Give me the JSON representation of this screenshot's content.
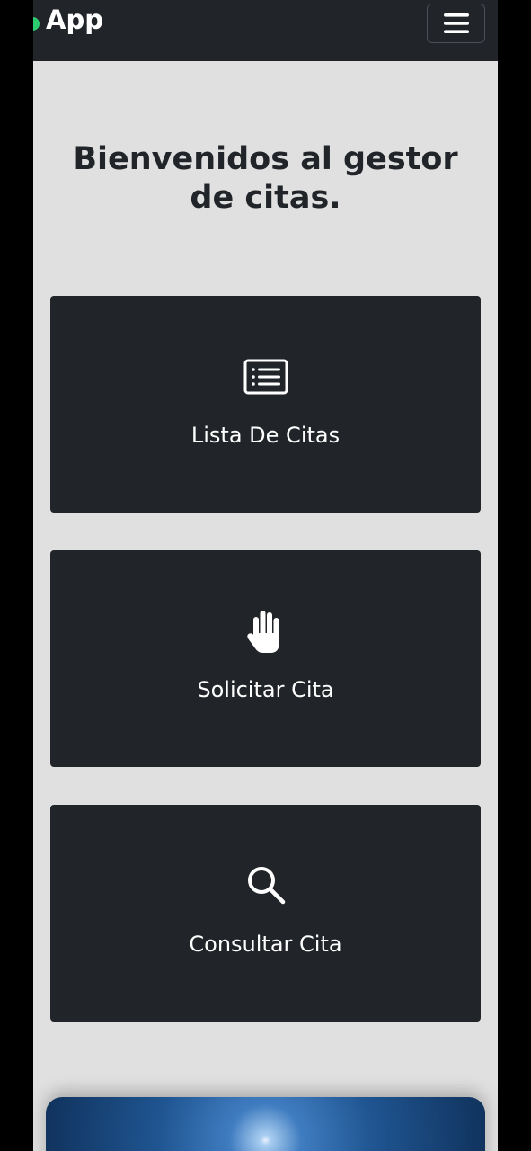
{
  "app": {
    "brand": "App",
    "status_color": "#2ecc71"
  },
  "navbar": {
    "toggler_icon": "hamburger-menu-icon"
  },
  "main": {
    "welcome_text": "Bienvenidos al gestor de citas.",
    "cards": [
      {
        "label": "Lista De Citas",
        "icon": "list-icon"
      },
      {
        "label": "Solicitar Cita",
        "icon": "hand-icon"
      },
      {
        "label": "Consultar Cita",
        "icon": "search-icon"
      }
    ]
  },
  "colors": {
    "navbar_bg": "#212529",
    "page_bg": "#e0e0e0",
    "card_bg": "#212529",
    "card_text": "#ffffff"
  }
}
